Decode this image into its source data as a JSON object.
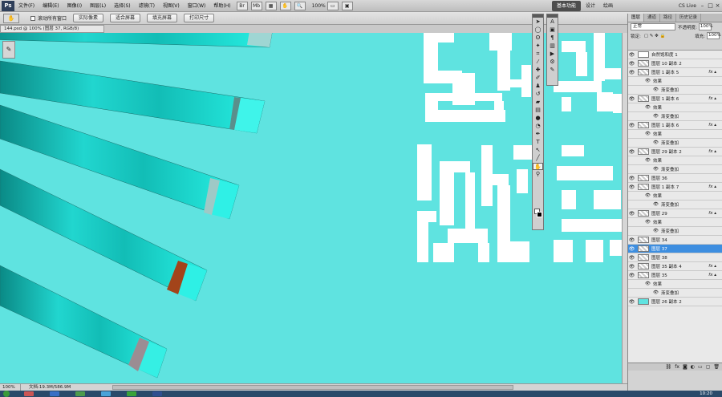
{
  "app": {
    "logo": "Ps",
    "zoom": "100%"
  },
  "menus": [
    "文件(F)",
    "编辑(E)",
    "图像(I)",
    "图层(L)",
    "选择(S)",
    "滤镜(T)",
    "视图(V)",
    "窗口(W)",
    "帮助(H)"
  ],
  "workspace": {
    "active": "基本功能",
    "others": [
      "设计",
      "绘画"
    ],
    "cslive": "CS Live"
  },
  "options": {
    "scroll_all_label": "滚动所有窗口",
    "buttons": [
      "实际像素",
      "适合屏幕",
      "填充屏幕",
      "打印尺寸"
    ]
  },
  "document": {
    "tab": "144.psd @ 100% (图层 37, RGB/8)"
  },
  "status": {
    "zoom": "100%",
    "doc": "文档:19.3M/586.9M"
  },
  "clock": "10:20",
  "layers_panel": {
    "tabs": [
      "图层",
      "通道",
      "路径",
      "历史记录"
    ],
    "blend_mode": "正常",
    "opacity_label": "不透明度:",
    "opacity": "100%",
    "lock_label": "锁定:",
    "fill_label": "填充:",
    "fill": "100%",
    "layers": [
      {
        "name": "自然饱和度 1",
        "type": "adj",
        "selected": false
      },
      {
        "name": "图层 10 副本 2",
        "type": "layer",
        "fx": false,
        "selected": false
      },
      {
        "name": "图层 1 副本 5",
        "type": "layer",
        "fx": true,
        "selected": false
      },
      {
        "name": "效果",
        "type": "sub"
      },
      {
        "name": "渐变叠加",
        "type": "sub2"
      },
      {
        "name": "图层 1 副本 6",
        "type": "layer",
        "fx": true,
        "selected": false
      },
      {
        "name": "效果",
        "type": "sub"
      },
      {
        "name": "渐变叠加",
        "type": "sub2"
      },
      {
        "name": "图层 1 副本 6",
        "type": "layer",
        "fx": true,
        "selected": false
      },
      {
        "name": "效果",
        "type": "sub"
      },
      {
        "name": "渐变叠加",
        "type": "sub2"
      },
      {
        "name": "图层 29 副本 2",
        "type": "layer",
        "fx": true,
        "selected": false
      },
      {
        "name": "效果",
        "type": "sub"
      },
      {
        "name": "渐变叠加",
        "type": "sub2"
      },
      {
        "name": "图层 36",
        "type": "layer",
        "fx": false,
        "selected": false
      },
      {
        "name": "图层 1 副本 7",
        "type": "layer",
        "fx": true,
        "selected": false
      },
      {
        "name": "效果",
        "type": "sub"
      },
      {
        "name": "渐变叠加",
        "type": "sub2"
      },
      {
        "name": "图层 29",
        "type": "layer",
        "fx": true,
        "selected": false
      },
      {
        "name": "效果",
        "type": "sub"
      },
      {
        "name": "渐变叠加",
        "type": "sub2"
      },
      {
        "name": "图层 34",
        "type": "layer",
        "fx": false,
        "selected": false
      },
      {
        "name": "图层 37",
        "type": "layer",
        "fx": false,
        "selected": true
      },
      {
        "name": "图层 38",
        "type": "layer",
        "fx": false,
        "selected": false
      },
      {
        "name": "图层 35 副本 4",
        "type": "layer",
        "fx": true,
        "selected": false
      },
      {
        "name": "图层 35",
        "type": "layer",
        "fx": true,
        "selected": false
      },
      {
        "name": "效果",
        "type": "sub"
      },
      {
        "name": "渐变叠加",
        "type": "sub2"
      },
      {
        "name": "图层 26 副本 2",
        "type": "layer",
        "fx": false,
        "selected": false,
        "cyan": true
      }
    ]
  }
}
